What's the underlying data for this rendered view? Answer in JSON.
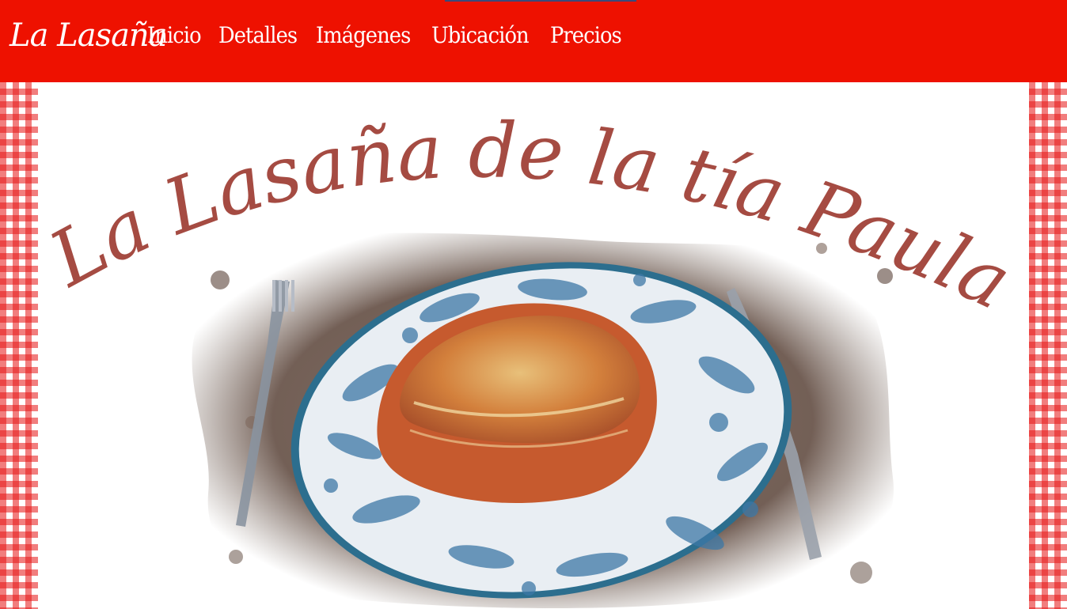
{
  "navbar": {
    "brand": "La Lasaña",
    "links": [
      "Inicio",
      "Detalles",
      "Imágenes",
      "Ubicación",
      "Precios"
    ]
  },
  "hero": {
    "title": "La Lasaña de la tía Paula"
  },
  "colors": {
    "navbar_bg": "#ee1100",
    "title_color": "#a54b42",
    "gingham_red": "#e61414"
  },
  "icons": [
    "fork-icon",
    "knife-icon"
  ]
}
